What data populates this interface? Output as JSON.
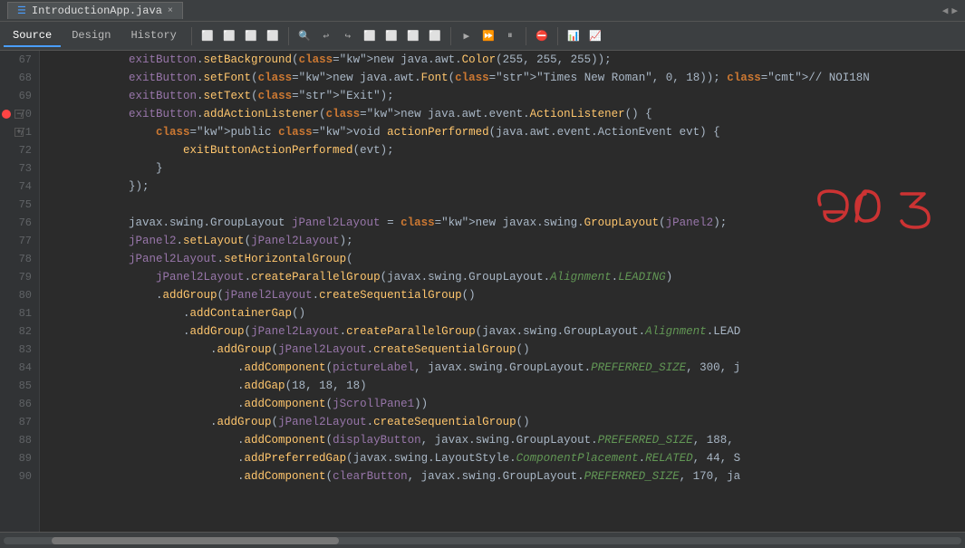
{
  "titlebar": {
    "tab_label": "IntroductionApp.java",
    "close_icon": "×",
    "nav_left": "◀",
    "nav_right": "▶"
  },
  "toolbar": {
    "tabs": [
      {
        "label": "Source",
        "active": true
      },
      {
        "label": "Design",
        "active": false
      },
      {
        "label": "History",
        "active": false
      }
    ]
  },
  "lines": [
    {
      "num": 67,
      "content": "            exitButton.setBackground(new java.awt.Color(255, 255, 255));"
    },
    {
      "num": 68,
      "content": "            exitButton.setFont(new java.awt.Font(\"Times New Roman\", 0, 18)); // NOI18N"
    },
    {
      "num": 69,
      "content": "            exitButton.setText(\"Exit\");"
    },
    {
      "num": 70,
      "content": "            exitButton.addActionListener(new java.awt.event.ActionListener() {"
    },
    {
      "num": 71,
      "content": "                public void actionPerformed(java.awt.event.ActionEvent evt) {"
    },
    {
      "num": 72,
      "content": "                    exitButtonActionPerformed(evt);"
    },
    {
      "num": 73,
      "content": "                }"
    },
    {
      "num": 74,
      "content": "            });"
    },
    {
      "num": 75,
      "content": ""
    },
    {
      "num": 76,
      "content": "            javax.swing.GroupLayout jPanel2Layout = new javax.swing.GroupLayout(jPanel2);"
    },
    {
      "num": 77,
      "content": "            jPanel2.setLayout(jPanel2Layout);"
    },
    {
      "num": 78,
      "content": "            jPanel2Layout.setHorizontalGroup("
    },
    {
      "num": 79,
      "content": "                jPanel2Layout.createParallelGroup(javax.swing.GroupLayout.Alignment.LEADING)"
    },
    {
      "num": 80,
      "content": "                .addGroup(jPanel2Layout.createSequentialGroup()"
    },
    {
      "num": 81,
      "content": "                    .addContainerGap()"
    },
    {
      "num": 82,
      "content": "                    .addGroup(jPanel2Layout.createParallelGroup(javax.swing.GroupLayout.Alignment.LEAD"
    },
    {
      "num": 83,
      "content": "                        .addGroup(jPanel2Layout.createSequentialGroup()"
    },
    {
      "num": 84,
      "content": "                            .addComponent(pictureLabel, javax.swing.GroupLayout.PREFERRED_SIZE, 300, j"
    },
    {
      "num": 85,
      "content": "                            .addGap(18, 18, 18)"
    },
    {
      "num": 86,
      "content": "                            .addComponent(jScrollPane1))"
    },
    {
      "num": 87,
      "content": "                        .addGroup(jPanel2Layout.createSequentialGroup()"
    },
    {
      "num": 88,
      "content": "                            .addComponent(displayButton, javax.swing.GroupLayout.PREFERRED_SIZE, 188,"
    },
    {
      "num": 89,
      "content": "                            .addPreferredGap(javax.swing.LayoutStyle.ComponentPlacement.RELATED, 44, S"
    },
    {
      "num": 90,
      "content": "                            .addComponent(clearButton, javax.swing.GroupLayout.PREFERRED_SIZE, 170, ja"
    }
  ],
  "gc_annotation": "GC 3",
  "special_lines": {
    "breakpoint_line": 70,
    "fold_lines": [
      70,
      71
    ]
  }
}
